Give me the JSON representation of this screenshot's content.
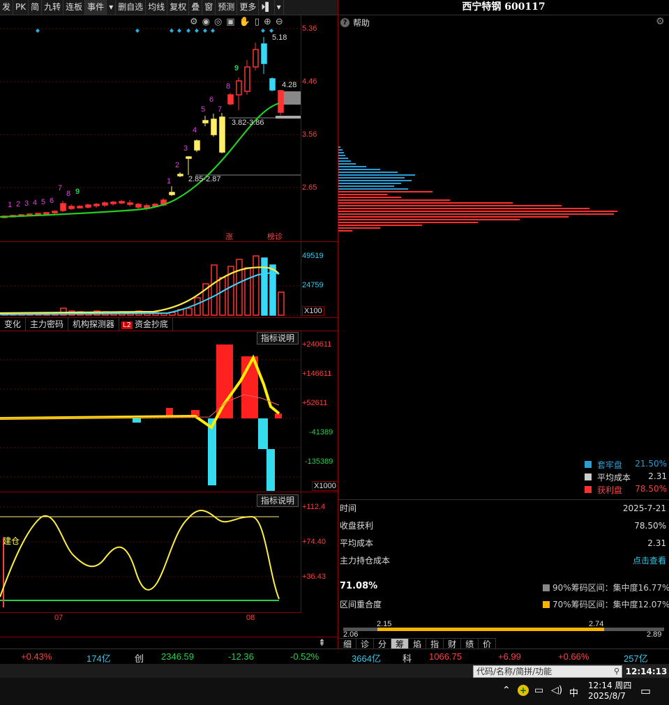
{
  "toolbar": {
    "items": [
      "发",
      "PK",
      "简",
      "九转",
      "连板",
      "事件",
      "▾",
      "删自选",
      "均线",
      "复权",
      "叠",
      "窗",
      "预测",
      "更多",
      "⏵▌",
      "▾"
    ]
  },
  "price_axis": [
    "5.36",
    "4.46",
    "3.56",
    "2.65"
  ],
  "price_annotations": {
    "high": "5.18",
    "last": "4.28",
    "range1": "3.82-3.86",
    "range2": "2.85-2.87",
    "badge1": "涨",
    "badge2": "榜诊"
  },
  "nine_turn_counts": [
    "1",
    "2",
    "3",
    "4",
    "5",
    "6",
    "7",
    "8",
    "9"
  ],
  "volume_axis": [
    "49519",
    "24759",
    "X100"
  ],
  "indicator_tabs": [
    "变化",
    "主力密码",
    "机构探测器",
    "L2",
    "资金抄底"
  ],
  "indicator_explain": "指标说明",
  "fund_axis": [
    "+240611",
    "+146611",
    "+52611",
    "-41389",
    "-135389",
    "X1000"
  ],
  "osc_axis": [
    "+112.4",
    "+74.40",
    "+36.43"
  ],
  "osc_marks": {
    "build": "建仓"
  },
  "date_axis": [
    "07",
    "08"
  ],
  "right_panel": {
    "title": "西宁特钢 600117",
    "help": "帮助",
    "legend": [
      {
        "label": "套牢盘",
        "value": "21.50%",
        "color": "#2a9fd6"
      },
      {
        "label": "平均成本",
        "value": "2.31",
        "color": "#cccccc"
      },
      {
        "label": "获利盘",
        "value": "78.50%",
        "color": "#ff3030"
      }
    ],
    "rows": [
      {
        "label": "时间",
        "value": "2025-7-21"
      },
      {
        "label": "收盘获利",
        "value": "78.50%"
      },
      {
        "label": "平均成本",
        "value": "2.31"
      },
      {
        "label": "主力持仓成本",
        "value": "点击查看"
      }
    ],
    "concentration": {
      "overlap_value": "71.08%",
      "overlap_label": "区间重合度",
      "c90": "90%筹码区间：集中度16.77%",
      "c70": "70%筹码区间：集中度12.07%"
    },
    "range_bar": {
      "min": "2.06",
      "max": "2.89",
      "lo": "2.15",
      "hi": "2.74"
    },
    "tabs": [
      "细",
      "诊",
      "分",
      "筹",
      "焰",
      "指",
      "财",
      "绩",
      "价"
    ]
  },
  "status": {
    "pct1": "+0.43%",
    "amt1": "174亿",
    "idx_name": "创",
    "idx_value": "2346.59",
    "idx_change": "-12.36",
    "idx_pct": "-0.52%",
    "amt2": "3664亿",
    "idx2_name": "科",
    "idx2_value": "1066.75",
    "idx2_change": "+6.99",
    "idx2_pct": "+0.66%",
    "amt3": "257亿"
  },
  "search": {
    "placeholder": "代码/名称/简拼/功能",
    "clock": "12:14:13"
  },
  "taskbar": {
    "time": "12:14 周四",
    "date": "2025/8/7",
    "ime": "中"
  }
}
